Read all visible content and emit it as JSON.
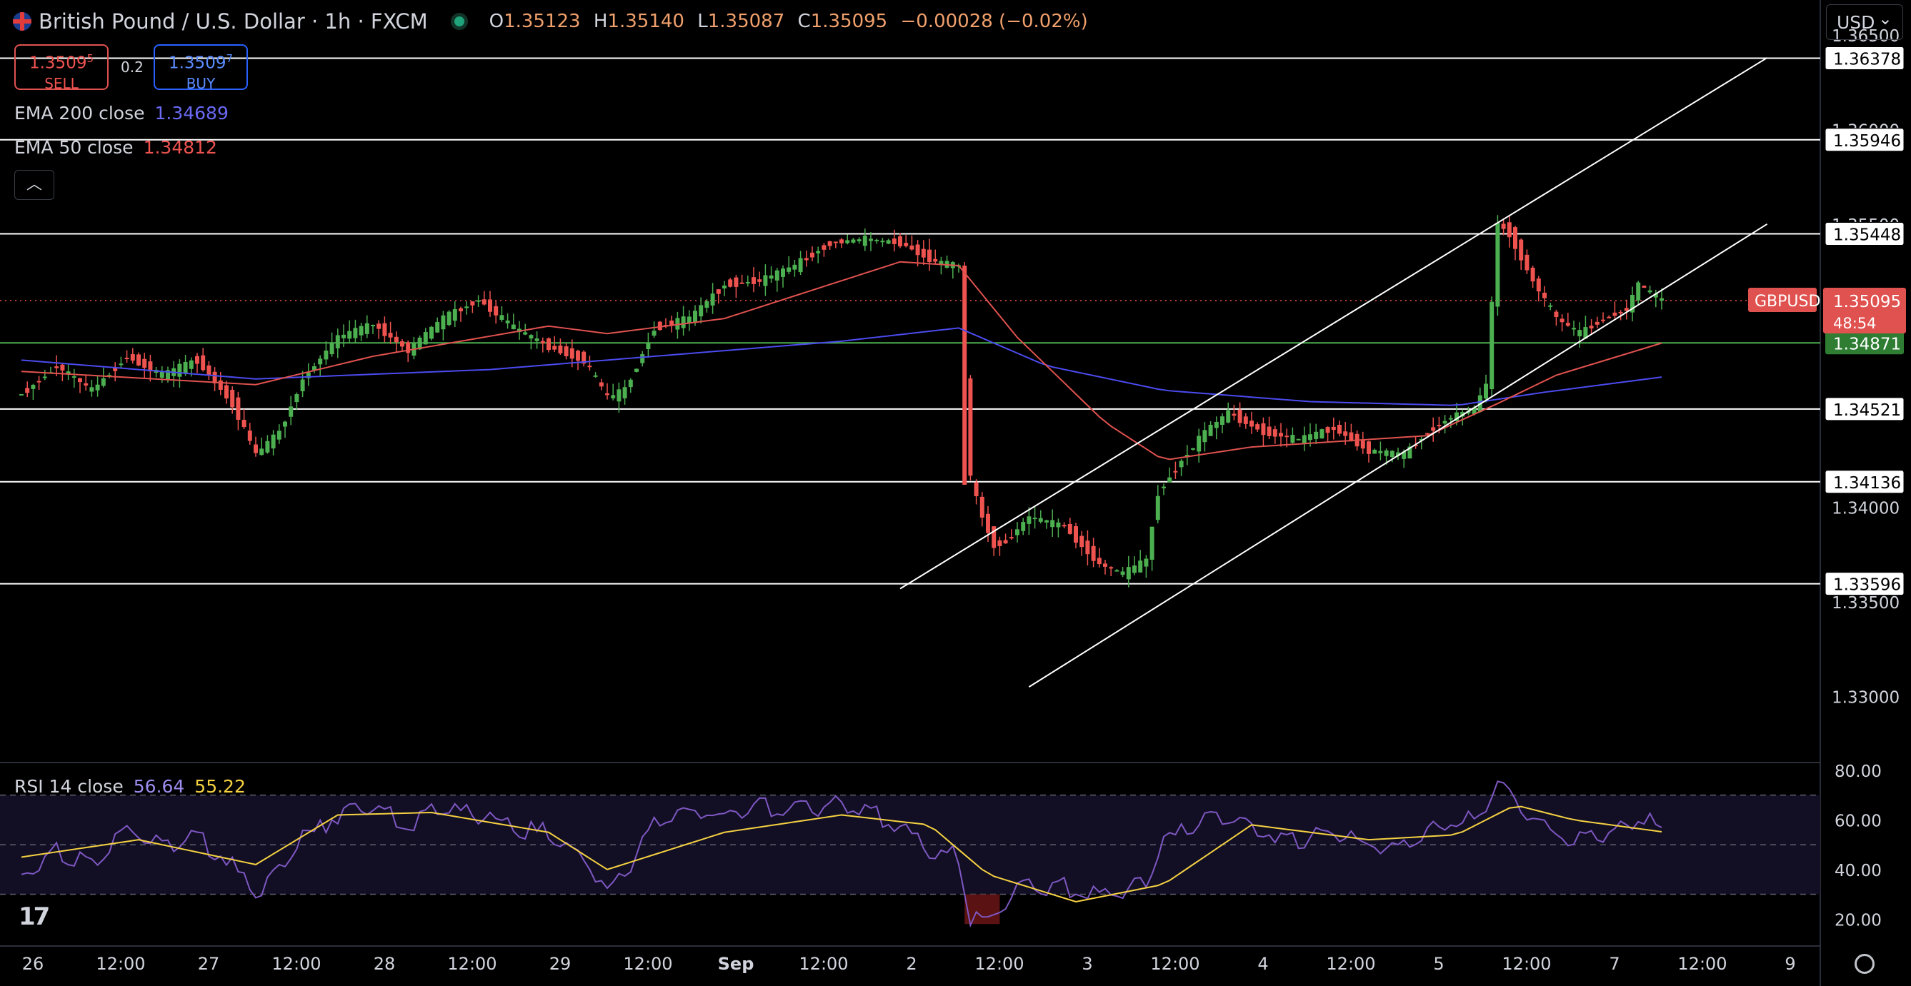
{
  "header": {
    "symbol": "British Pound / U.S. Dollar · 1h · FXCM",
    "open_label": "O",
    "open": "1.35123",
    "high_label": "H",
    "high": "1.35140",
    "low_label": "L",
    "low": "1.35087",
    "close_label": "C",
    "close": "1.35095",
    "change": "−0.00028 (−0.02%)"
  },
  "trade": {
    "sell_price": "1.3509",
    "sell_price_sup": "5",
    "sell_label": "SELL",
    "buy_price": "1.3509",
    "buy_price_sup": "7",
    "buy_label": "BUY",
    "spread": "0.2"
  },
  "indicators": {
    "ema200_label": "EMA 200 close",
    "ema200_value": "1.34689",
    "ema200_color": "#4b4bf0",
    "ema50_label": "EMA 50 close",
    "ema50_value": "1.34812",
    "ema50_color": "#e0524f",
    "rsi_label": "RSI 14 close",
    "rsi_value": "56.64",
    "rsi_ma_value": "55.22",
    "rsi_color": "#7e57c2",
    "rsi_ma_color": "#f5d142"
  },
  "currency_select": "USD",
  "colors": {
    "up": "#4caf50",
    "down": "#ef5350",
    "background": "#000000"
  },
  "icons": {
    "collapse": "chevron-up-icon",
    "logo": "tradingview-logo-icon",
    "settings": "gear-icon"
  },
  "chart_data": [
    {
      "type": "candlestick",
      "title": "British Pound / U.S. Dollar · 1h · FXCM",
      "timeframe": "1h",
      "price_axis": {
        "ylim": [
          1.3265,
          1.3658
        ],
        "ticks": [
          "1.36500",
          "1.36000",
          "1.35500",
          "1.35000",
          "1.34500",
          "1.34000",
          "1.33500",
          "1.33000"
        ]
      },
      "time_axis": {
        "labels": [
          "26",
          "12:00",
          "27",
          "12:00",
          "28",
          "12:00",
          "29",
          "12:00",
          "Sep",
          "12:00",
          "2",
          "12:00",
          "3",
          "12:00",
          "4",
          "12:00",
          "5",
          "12:00",
          "7",
          "12:00",
          "9"
        ]
      },
      "horizontal_levels": [
        {
          "value": 1.36378,
          "label": "1.36378",
          "color": "#ffffff"
        },
        {
          "value": 1.35946,
          "label": "1.35946",
          "color": "#ffffff"
        },
        {
          "value": 1.35448,
          "label": "1.35448",
          "color": "#ffffff"
        },
        {
          "value": 1.34871,
          "label": "1.34871",
          "color": "#4caf50"
        },
        {
          "value": 1.34521,
          "label": "1.34521",
          "color": "#ffffff"
        },
        {
          "value": 1.34136,
          "label": "1.34136",
          "color": "#ffffff"
        },
        {
          "value": 1.33596,
          "label": "1.33596",
          "color": "#ffffff"
        }
      ],
      "last_price": {
        "symbol": "GBPUSD",
        "value": "1.35095",
        "countdown": "48:54"
      },
      "price_path": [
        [
          0,
          1.346
        ],
        [
          6,
          1.3475
        ],
        [
          12,
          1.3462
        ],
        [
          18,
          1.348
        ],
        [
          24,
          1.347
        ],
        [
          30,
          1.3478
        ],
        [
          36,
          1.3455
        ],
        [
          40,
          1.3428
        ],
        [
          44,
          1.344
        ],
        [
          48,
          1.3468
        ],
        [
          54,
          1.349
        ],
        [
          60,
          1.3497
        ],
        [
          66,
          1.3483
        ],
        [
          72,
          1.35
        ],
        [
          78,
          1.351
        ],
        [
          84,
          1.3495
        ],
        [
          90,
          1.3485
        ],
        [
          96,
          1.3478
        ],
        [
          100,
          1.3458
        ],
        [
          103,
          1.3462
        ],
        [
          108,
          1.3495
        ],
        [
          114,
          1.35
        ],
        [
          120,
          1.3518
        ],
        [
          126,
          1.352
        ],
        [
          132,
          1.3528
        ],
        [
          138,
          1.354
        ],
        [
          144,
          1.3542
        ],
        [
          150,
          1.354
        ],
        [
          156,
          1.353
        ],
        [
          160,
          1.3528
        ],
        [
          162,
          1.3415
        ],
        [
          164,
          1.3395
        ],
        [
          166,
          1.338
        ],
        [
          168,
          1.3382
        ],
        [
          172,
          1.3395
        ],
        [
          178,
          1.339
        ],
        [
          184,
          1.337
        ],
        [
          188,
          1.3365
        ],
        [
          192,
          1.3372
        ],
        [
          194,
          1.3408
        ],
        [
          198,
          1.3425
        ],
        [
          202,
          1.344
        ],
        [
          206,
          1.345
        ],
        [
          212,
          1.344
        ],
        [
          218,
          1.3436
        ],
        [
          224,
          1.3442
        ],
        [
          230,
          1.343
        ],
        [
          236,
          1.3428
        ],
        [
          240,
          1.344
        ],
        [
          244,
          1.3448
        ],
        [
          248,
          1.3452
        ],
        [
          250,
          1.3465
        ],
        [
          252,
          1.355
        ],
        [
          254,
          1.3545
        ],
        [
          258,
          1.352
        ],
        [
          262,
          1.35
        ],
        [
          266,
          1.3492
        ],
        [
          270,
          1.35
        ],
        [
          274,
          1.3505
        ],
        [
          276,
          1.3518
        ],
        [
          280,
          1.35095
        ]
      ],
      "ema50": [
        [
          0,
          1.3472
        ],
        [
          40,
          1.3465
        ],
        [
          60,
          1.348
        ],
        [
          90,
          1.3496
        ],
        [
          100,
          1.3492
        ],
        [
          120,
          1.35
        ],
        [
          140,
          1.352
        ],
        [
          150,
          1.353
        ],
        [
          160,
          1.3528
        ],
        [
          170,
          1.349
        ],
        [
          185,
          1.3445
        ],
        [
          195,
          1.3425
        ],
        [
          210,
          1.3432
        ],
        [
          240,
          1.3438
        ],
        [
          252,
          1.3455
        ],
        [
          262,
          1.347
        ],
        [
          280,
          1.3487
        ]
      ],
      "ema200": [
        [
          0,
          1.3478
        ],
        [
          40,
          1.3468
        ],
        [
          80,
          1.3473
        ],
        [
          100,
          1.3478
        ],
        [
          140,
          1.3488
        ],
        [
          160,
          1.3495
        ],
        [
          175,
          1.3475
        ],
        [
          195,
          1.3462
        ],
        [
          220,
          1.3456
        ],
        [
          245,
          1.3454
        ],
        [
          260,
          1.3461
        ],
        [
          280,
          1.3469
        ]
      ],
      "channel": {
        "upper": [
          [
            150,
            1.3357
          ],
          [
            298,
            1.3638
          ]
        ],
        "lower": [
          [
            172,
            1.3305
          ],
          [
            298,
            1.355
          ]
        ]
      }
    },
    {
      "type": "line",
      "title": "RSI 14 close",
      "ylim": [
        10,
        82
      ],
      "ticks": [
        "80.00",
        "60.00",
        "40.00",
        "20.00"
      ],
      "bands": [
        70,
        50,
        30
      ],
      "series": [
        {
          "name": "RSI",
          "color": "#7e57c2",
          "values": [
            [
              0,
              38
            ],
            [
              6,
              48
            ],
            [
              12,
              41
            ],
            [
              18,
              55
            ],
            [
              24,
              50
            ],
            [
              30,
              53
            ],
            [
              36,
              42
            ],
            [
              40,
              30
            ],
            [
              44,
              38
            ],
            [
              48,
              52
            ],
            [
              54,
              62
            ],
            [
              60,
              66
            ],
            [
              66,
              58
            ],
            [
              72,
              65
            ],
            [
              78,
              62
            ],
            [
              84,
              56
            ],
            [
              90,
              55
            ],
            [
              96,
              46
            ],
            [
              100,
              32
            ],
            [
              103,
              38
            ],
            [
              108,
              60
            ],
            [
              114,
              64
            ],
            [
              120,
              62
            ],
            [
              126,
              66
            ],
            [
              132,
              64
            ],
            [
              138,
              66
            ],
            [
              144,
              64
            ],
            [
              150,
              58
            ],
            [
              156,
              45
            ],
            [
              160,
              46
            ],
            [
              162,
              20
            ],
            [
              164,
              18
            ],
            [
              166,
              20
            ],
            [
              168,
              28
            ],
            [
              172,
              34
            ],
            [
              178,
              33
            ],
            [
              184,
              30
            ],
            [
              188,
              31
            ],
            [
              192,
              35
            ],
            [
              194,
              48
            ],
            [
              198,
              55
            ],
            [
              202,
              62
            ],
            [
              206,
              60
            ],
            [
              212,
              56
            ],
            [
              218,
              52
            ],
            [
              224,
              56
            ],
            [
              230,
              50
            ],
            [
              236,
              50
            ],
            [
              240,
              56
            ],
            [
              244,
              58
            ],
            [
              248,
              60
            ],
            [
              250,
              64
            ],
            [
              252,
              78
            ],
            [
              254,
              70
            ],
            [
              258,
              62
            ],
            [
              262,
              54
            ],
            [
              266,
              52
            ],
            [
              270,
              55
            ],
            [
              274,
              57
            ],
            [
              276,
              61
            ],
            [
              280,
              56.64
            ]
          ]
        },
        {
          "name": "MA",
          "color": "#f5d142",
          "values": [
            [
              0,
              45
            ],
            [
              20,
              52
            ],
            [
              40,
              42
            ],
            [
              54,
              62
            ],
            [
              70,
              63
            ],
            [
              90,
              55
            ],
            [
              100,
              40
            ],
            [
              120,
              55
            ],
            [
              140,
              62
            ],
            [
              155,
              58
            ],
            [
              165,
              38
            ],
            [
              180,
              27
            ],
            [
              195,
              34
            ],
            [
              210,
              58
            ],
            [
              230,
              52
            ],
            [
              245,
              54
            ],
            [
              255,
              66
            ],
            [
              265,
              60
            ],
            [
              280,
              55.22
            ]
          ]
        }
      ]
    }
  ]
}
